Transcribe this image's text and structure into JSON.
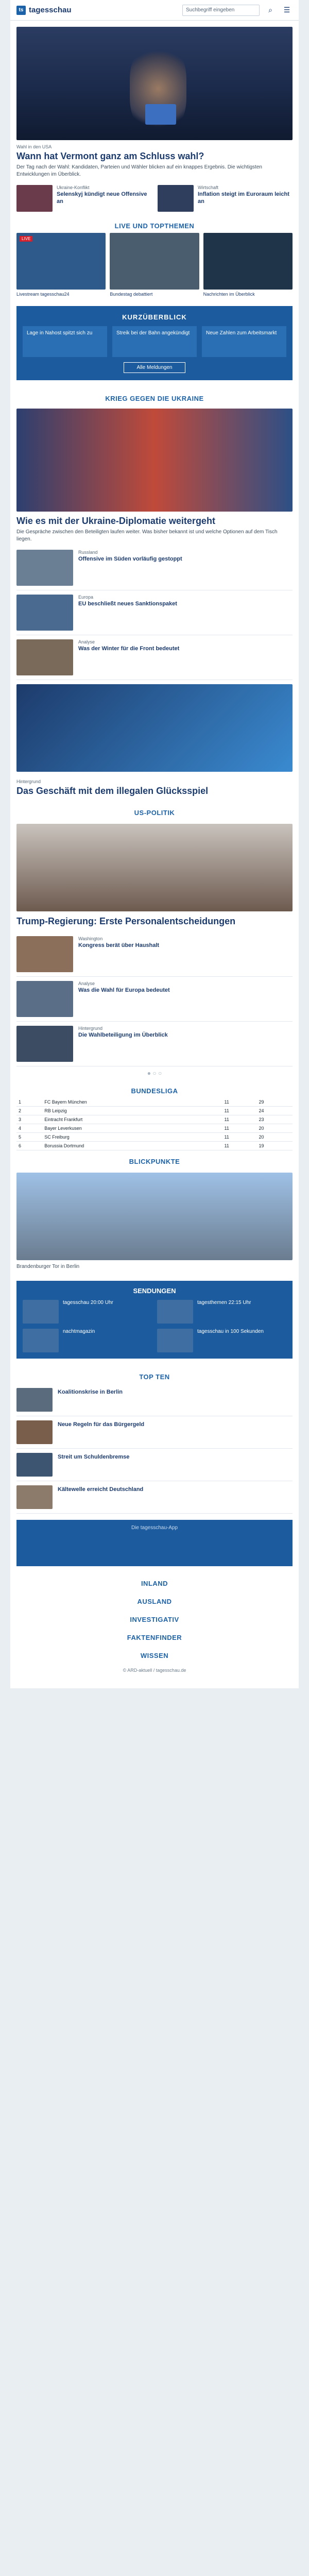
{
  "header": {
    "logo": "tagesschau",
    "search_placeholder": "Suchbegriff eingeben"
  },
  "hero": {
    "topline": "Wahl in den USA",
    "headline": "Wann hat Vermont ganz am Schluss wahl?",
    "teaser": "Der Tag nach der Wahl: Kandidaten, Parteien und Wähler blicken auf ein knappes Ergebnis. Die wichtigsten Entwicklungen im Überblick."
  },
  "cards_top": [
    {
      "topline": "Ukraine-Konflikt",
      "title": "Selenskyj kündigt neue Offensive an"
    },
    {
      "topline": "Wirtschaft",
      "title": "Inflation steigt im Euroraum leicht an"
    }
  ],
  "sections": {
    "live": "LIVE UND TOPTHEMEN",
    "brief": "KURZÜBERBLICK",
    "krieg": "KRIEG GEGEN DIE UKRAINE",
    "us": "US-POLITIK",
    "bundesliga": "BUNDESLIGA",
    "blickpunkte": "BLICKPUNKTE",
    "sendungen": "SENDUNGEN",
    "topten": "TOP TEN",
    "inland": "INLAND",
    "ausland": "AUSLAND",
    "investigativ": "INVESTIGATIV",
    "faktenfinder": "FAKTENFINDER",
    "wissen": "WISSEN"
  },
  "videos": [
    {
      "label": "LIVE",
      "caption": "Livestream tagesschau24"
    },
    {
      "label": "",
      "caption": "Bundestag debattiert"
    },
    {
      "label": "",
      "caption": "Nachrichten im Überblick"
    }
  ],
  "brief_items": [
    "Lage in Nahost spitzt sich zu",
    "Streik bei der Bahn angekündigt",
    "Neue Zahlen zum Arbeitsmarkt"
  ],
  "brief_button": "Alle Meldungen",
  "krieg": {
    "headline": "Wie es mit der Ukraine-Diplomatie weitergeht",
    "teaser": "Die Gespräche zwischen den Beteiligten laufen weiter. Was bisher bekannt ist und welche Optionen auf dem Tisch liegen.",
    "items": [
      {
        "topline": "Russland",
        "title": "Offensive im Süden vorläufig gestoppt"
      },
      {
        "topline": "Europa",
        "title": "EU beschließt neues Sanktionspaket"
      },
      {
        "topline": "Analyse",
        "title": "Was der Winter für die Front bedeutet"
      },
      {
        "topline": "Hintergrund",
        "title": "Das Geschäft mit dem illegalen Glücksspiel"
      }
    ]
  },
  "us": {
    "headline": "Trump-Regierung: Erste Personalentscheidungen",
    "items": [
      {
        "topline": "Washington",
        "title": "Kongress berät über Haushalt"
      },
      {
        "topline": "Analyse",
        "title": "Was die Wahl für Europa bedeutet"
      },
      {
        "topline": "Hintergrund",
        "title": "Die Wahlbeteiligung im Überblick"
      }
    ]
  },
  "bundesliga": {
    "rows": [
      [
        "1",
        "FC Bayern München",
        "11",
        "29"
      ],
      [
        "2",
        "RB Leipzig",
        "11",
        "24"
      ],
      [
        "3",
        "Eintracht Frankfurt",
        "11",
        "23"
      ],
      [
        "4",
        "Bayer Leverkusen",
        "11",
        "20"
      ],
      [
        "5",
        "SC Freiburg",
        "11",
        "20"
      ],
      [
        "6",
        "Borussia Dortmund",
        "11",
        "19"
      ]
    ]
  },
  "blickpunkte": {
    "caption": "Brandenburger Tor in Berlin"
  },
  "sendungen": [
    {
      "title": "tagesschau 20:00 Uhr"
    },
    {
      "title": "tagesthemen 22:15 Uhr"
    },
    {
      "title": "nachtmagazin"
    },
    {
      "title": "tagesschau in 100 Sekunden"
    }
  ],
  "topten": [
    {
      "title": "Koalitionskrise in Berlin"
    },
    {
      "title": "Neue Regeln für das Bürgergeld"
    },
    {
      "title": "Streit um Schuldenbremse"
    },
    {
      "title": "Kältewelle erreicht Deutschland"
    }
  ],
  "ad_text": "Die tagesschau-App",
  "footer": "© ARD-aktuell / tagesschau.de"
}
